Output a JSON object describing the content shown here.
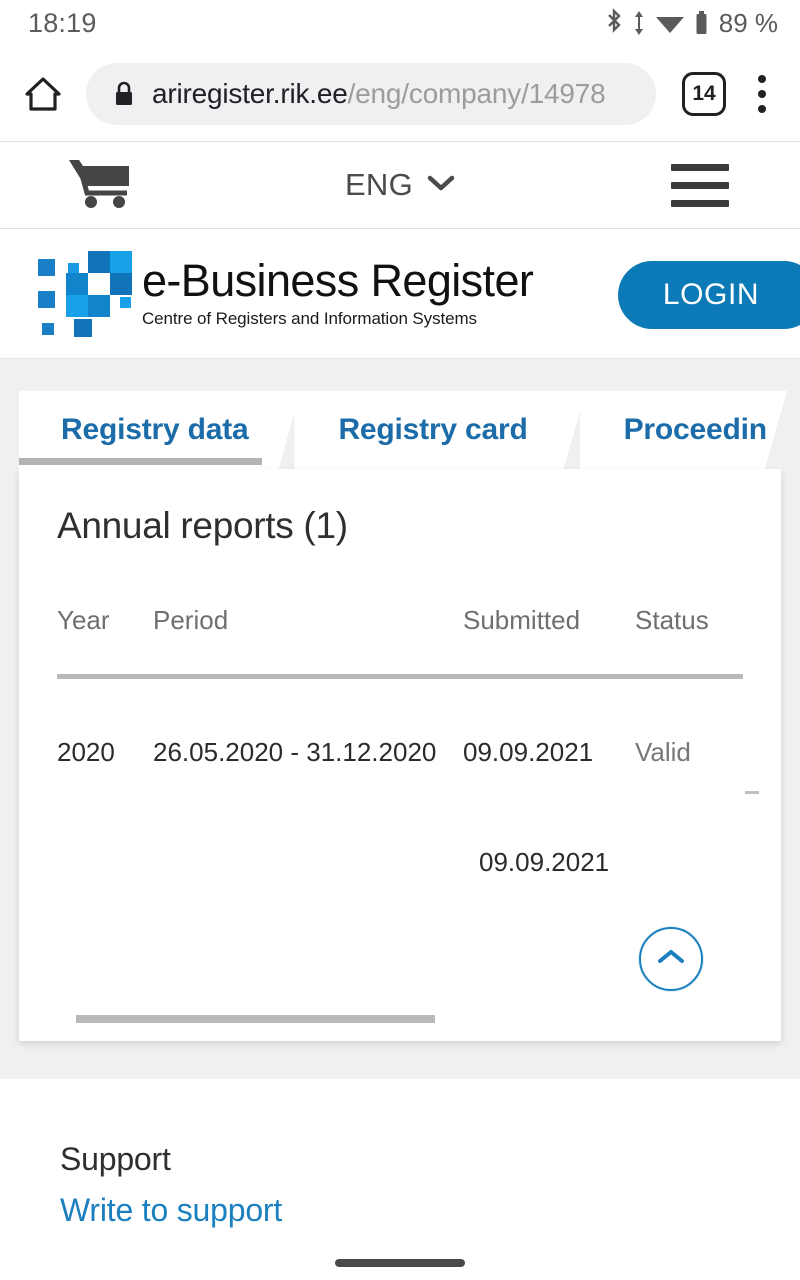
{
  "status_bar": {
    "time": "18:19",
    "battery": "89 %",
    "icons": [
      "bluetooth-icon",
      "data-transfer-icon",
      "wifi-icon",
      "battery-icon"
    ]
  },
  "browser": {
    "home_icon": "home-icon",
    "lock_icon": "lock-icon",
    "url_domain": "ariregister.rik.ee",
    "url_path": "/eng/company/14978",
    "tab_count": "14",
    "menu_icon": "kebab-menu-icon"
  },
  "site_header": {
    "cart_icon": "shopping-cart-icon",
    "language": "ENG",
    "language_chevron": "chevron-down-icon",
    "menu_icon": "hamburger-menu-icon",
    "brand_title": "e-Business Register",
    "brand_subtitle": "Centre of Registers and Information Systems",
    "login_label": "LOGIN",
    "logo_icon": "e-business-register-logo",
    "accent_color": "#0d7ab8"
  },
  "tabs": [
    {
      "label": "Registry data",
      "active": true
    },
    {
      "label": "Registry card",
      "active": false
    },
    {
      "label": "Proceedin",
      "active": false
    }
  ],
  "main": {
    "card_title": "Annual reports (1)",
    "table": {
      "columns": [
        "Year",
        "Period",
        "Submitted",
        "Status"
      ],
      "rows": [
        {
          "year": "2020",
          "period": "26.05.2020 - 31.12.2020",
          "submitted": "09.09.2021",
          "status": "Valid"
        }
      ],
      "detail_date": "09.09.2021"
    },
    "scroll_top_icon": "chevron-up-icon"
  },
  "footer": {
    "title": "Support",
    "link": "Write to support"
  }
}
